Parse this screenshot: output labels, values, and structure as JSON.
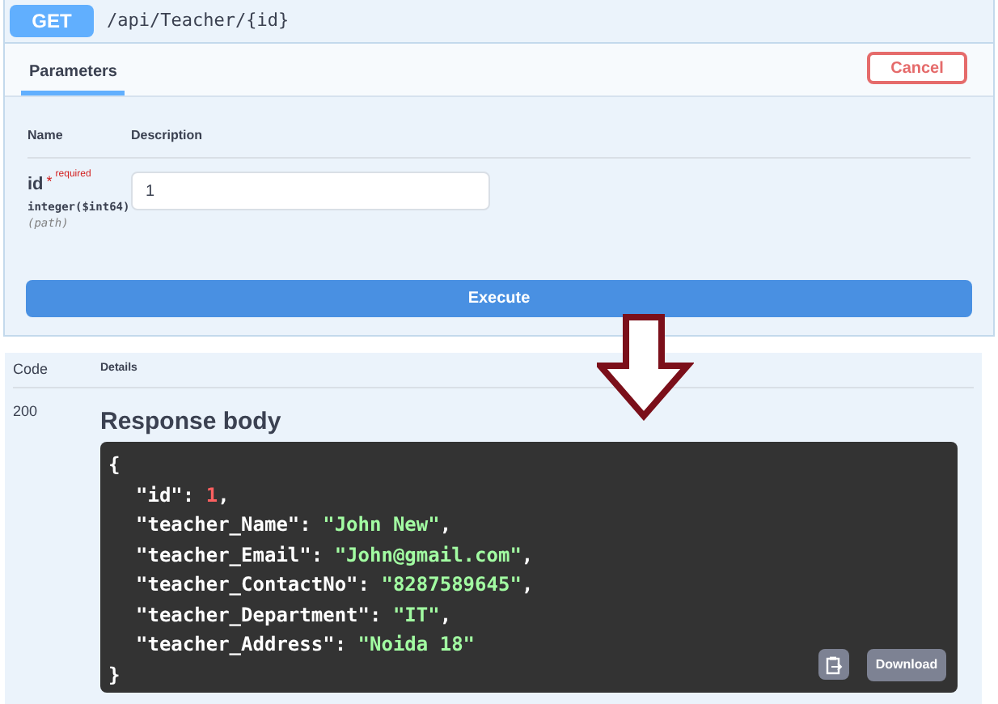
{
  "operation": {
    "method": "GET",
    "path": "/api/Teacher/{id}"
  },
  "tabs": [
    {
      "label": "Parameters",
      "selected": true
    }
  ],
  "cancel_button": "Cancel",
  "parameters": {
    "columns": [
      "Name",
      "Description"
    ],
    "rows": [
      {
        "name": "id",
        "required_mark": "*",
        "required_label": "required",
        "type": "integer($int64)",
        "location": "(path)",
        "value": "1"
      }
    ]
  },
  "execute_button": "Execute",
  "responses": {
    "columns": [
      "Code",
      "Details"
    ],
    "code": "200",
    "heading": "Response body",
    "body_open": "{",
    "body_close": "}",
    "lines": [
      {
        "key": "\"id\"",
        "sep": ": ",
        "value": "1",
        "kind": "number",
        "end": ","
      },
      {
        "key": "\"teacher_Name\"",
        "sep": ": ",
        "value": "\"John New\"",
        "kind": "string",
        "end": ","
      },
      {
        "key": "\"teacher_Email\"",
        "sep": ": ",
        "value": "\"John@gmail.com\"",
        "kind": "string",
        "end": ","
      },
      {
        "key": "\"teacher_ContactNo\"",
        "sep": ": ",
        "value": "\"8287589645\"",
        "kind": "string",
        "end": ","
      },
      {
        "key": "\"teacher_Department\"",
        "sep": ": ",
        "value": "\"IT\"",
        "kind": "string",
        "end": ","
      },
      {
        "key": "\"teacher_Address\"",
        "sep": ": ",
        "value": "\"Noida 18\"",
        "kind": "string"
      }
    ],
    "download_button": "Download"
  }
}
